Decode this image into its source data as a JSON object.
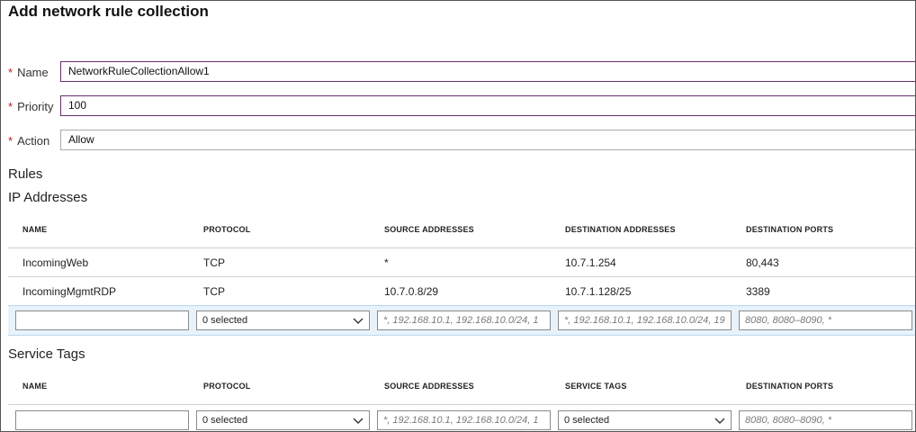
{
  "title": "Add network rule collection",
  "form": {
    "required_marker": "*",
    "name": {
      "label": "Name",
      "value": "NetworkRuleCollectionAllow1"
    },
    "priority": {
      "label": "Priority",
      "value": "100"
    },
    "action": {
      "label": "Action",
      "value": "Allow"
    }
  },
  "rules_heading": "Rules",
  "ip_section": {
    "heading": "IP Addresses",
    "headers": [
      "NAME",
      "PROTOCOL",
      "SOURCE ADDRESSES",
      "DESTINATION ADDRESSES",
      "DESTINATION PORTS"
    ],
    "rows": [
      [
        "IncomingWeb",
        "TCP",
        "*",
        "10.7.1.254",
        "80,443"
      ],
      [
        "IncomingMgmtRDP",
        "TCP",
        "10.7.0.8/29",
        "10.7.1.128/25",
        "3389"
      ]
    ],
    "new_row": {
      "name_value": "",
      "protocol_value": "0 selected",
      "source_placeholder": "*, 192.168.10.1, 192.168.10.0/24, 1",
      "destination_placeholder": "*, 192.168.10.1, 192.168.10.0/24, 19",
      "ports_placeholder": "8080, 8080–8090, *"
    }
  },
  "service_tags_section": {
    "heading": "Service Tags",
    "headers": [
      "NAME",
      "PROTOCOL",
      "SOURCE ADDRESSES",
      "SERVICE TAGS",
      "DESTINATION PORTS"
    ],
    "new_row": {
      "name_value": "",
      "protocol_value": "0 selected",
      "source_placeholder": "*, 192.168.10.1, 192.168.10.0/24, 1",
      "service_tags_value": "0 selected",
      "ports_placeholder": "8080, 8080–8090, *"
    }
  },
  "colors": {
    "accent_border": "#6b2e6b",
    "required": "#b01e1e",
    "selected_row": "#e8f2fb"
  },
  "icons": {
    "dropdown": "chevron-down-icon"
  }
}
